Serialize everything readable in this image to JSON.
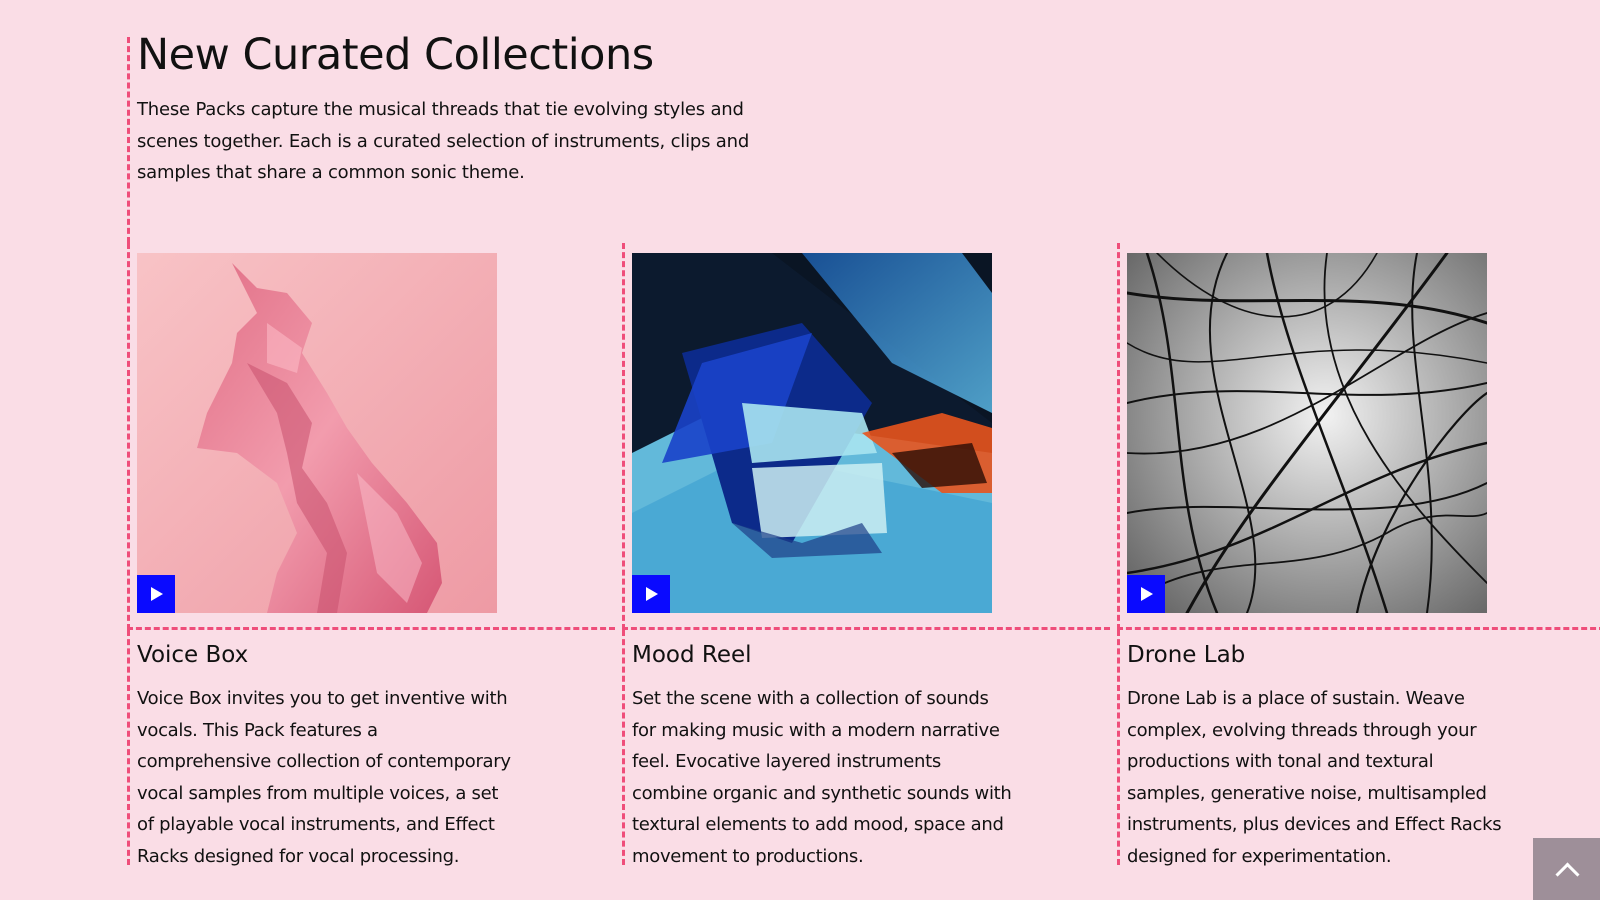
{
  "section": {
    "title": "New Curated Collections",
    "description": "These Packs capture the musical threads that tie evolving styles and scenes together. Each is a curated selection of instruments, clips and samples that share a common sonic theme."
  },
  "cards": [
    {
      "title": "Voice Box",
      "description": "Voice Box invites you to get inventive with vocals. This Pack features a comprehensive collection of contemporary vocal samples from multiple voices, a set of playable vocal instruments, and Effect Racks designed for vocal processing.",
      "image_icon": "pink-fabric-image",
      "play_icon": "play-icon"
    },
    {
      "title": "Mood Reel",
      "description": "Set the scene with a collection of sounds for making music with a modern narrative feel. Evocative layered instruments combine organic and synthetic sounds with textural elements to add mood, space and movement to productions.",
      "image_icon": "glass-prisms-image",
      "play_icon": "play-icon"
    },
    {
      "title": "Drone Lab",
      "description": "Drone Lab is a place of sustain. Weave complex, evolving threads through your productions with tonal and textural samples, generative noise, multisampled instruments, plus devices and Effect Racks designed for experimentation.",
      "image_icon": "black-threads-image",
      "play_icon": "play-icon"
    }
  ],
  "back_to_top_icon": "chevron-up-icon",
  "colors": {
    "background": "#fadde6",
    "dashed_guides": "#ef4d7a",
    "play_button": "#0a0aff",
    "back_to_top": "#9e8f99"
  }
}
